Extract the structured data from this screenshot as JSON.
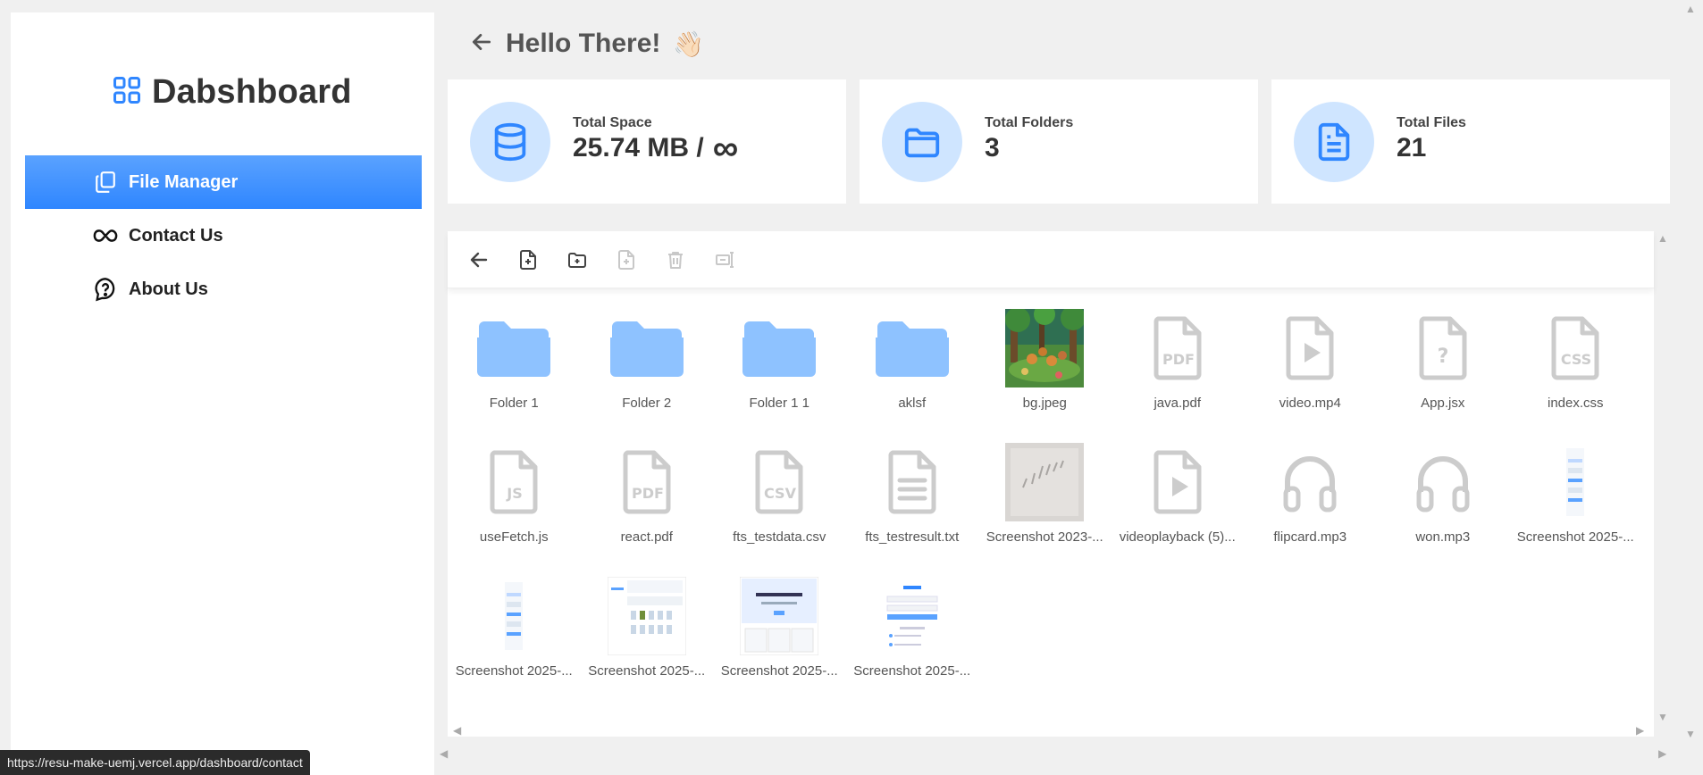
{
  "sidebar": {
    "brand": "Dabshboard",
    "items": [
      {
        "label": "File Manager",
        "icon": "files-icon",
        "active": true
      },
      {
        "label": "Contact Us",
        "icon": "infinity-icon",
        "active": false
      },
      {
        "label": "About Us",
        "icon": "help-icon",
        "active": false
      }
    ]
  },
  "header": {
    "title": "Hello There!",
    "emoji": "👋🏻"
  },
  "stats": [
    {
      "label": "Total Space",
      "value": "25.74 MB /",
      "suffix": "∞",
      "icon": "database-icon"
    },
    {
      "label": "Total Folders",
      "value": "3",
      "suffix": "",
      "icon": "folder-icon"
    },
    {
      "label": "Total Files",
      "value": "21",
      "suffix": "",
      "icon": "file-text-icon"
    }
  ],
  "toolbar": {
    "tools": [
      {
        "name": "back-tool-icon",
        "enabled": true
      },
      {
        "name": "new-file-icon",
        "enabled": true
      },
      {
        "name": "new-folder-icon",
        "enabled": true
      },
      {
        "name": "upload-icon",
        "enabled": false
      },
      {
        "name": "delete-icon",
        "enabled": false
      },
      {
        "name": "rename-icon",
        "enabled": false
      }
    ]
  },
  "files": [
    {
      "name": "Folder 1",
      "type": "folder"
    },
    {
      "name": "Folder 2",
      "type": "folder"
    },
    {
      "name": "Folder 1 1",
      "type": "folder"
    },
    {
      "name": "aklsf",
      "type": "folder"
    },
    {
      "name": "bg.jpeg",
      "type": "image-forest"
    },
    {
      "name": "java.pdf",
      "type": "pdf"
    },
    {
      "name": "video.mp4",
      "type": "video"
    },
    {
      "name": "App.jsx",
      "type": "unknown"
    },
    {
      "name": "index.css",
      "type": "css"
    },
    {
      "name": "useFetch.js",
      "type": "js"
    },
    {
      "name": "react.pdf",
      "type": "pdf"
    },
    {
      "name": "fts_testdata.csv",
      "type": "csv"
    },
    {
      "name": "fts_testresult.txt",
      "type": "txt"
    },
    {
      "name": "Screenshot 2023-...",
      "type": "image-gray"
    },
    {
      "name": "videoplayback (5)...",
      "type": "video"
    },
    {
      "name": "flipcard.mp3",
      "type": "audio"
    },
    {
      "name": "won.mp3",
      "type": "audio"
    },
    {
      "name": "Screenshot 2025-...",
      "type": "image-phone"
    },
    {
      "name": "Screenshot 2025-...",
      "type": "image-phone"
    },
    {
      "name": "Screenshot 2025-...",
      "type": "image-dash"
    },
    {
      "name": "Screenshot 2025-...",
      "type": "image-blue"
    },
    {
      "name": "Screenshot 2025-...",
      "type": "image-login"
    }
  ],
  "statusbar": {
    "url": "https://resu-make-uemj.vercel.app/dashboard/contact"
  },
  "colors": {
    "accent": "#2f86ff",
    "iconBg": "#cfe5ff",
    "folder": "#8ec2ff",
    "fileGray": "#cccccc"
  }
}
